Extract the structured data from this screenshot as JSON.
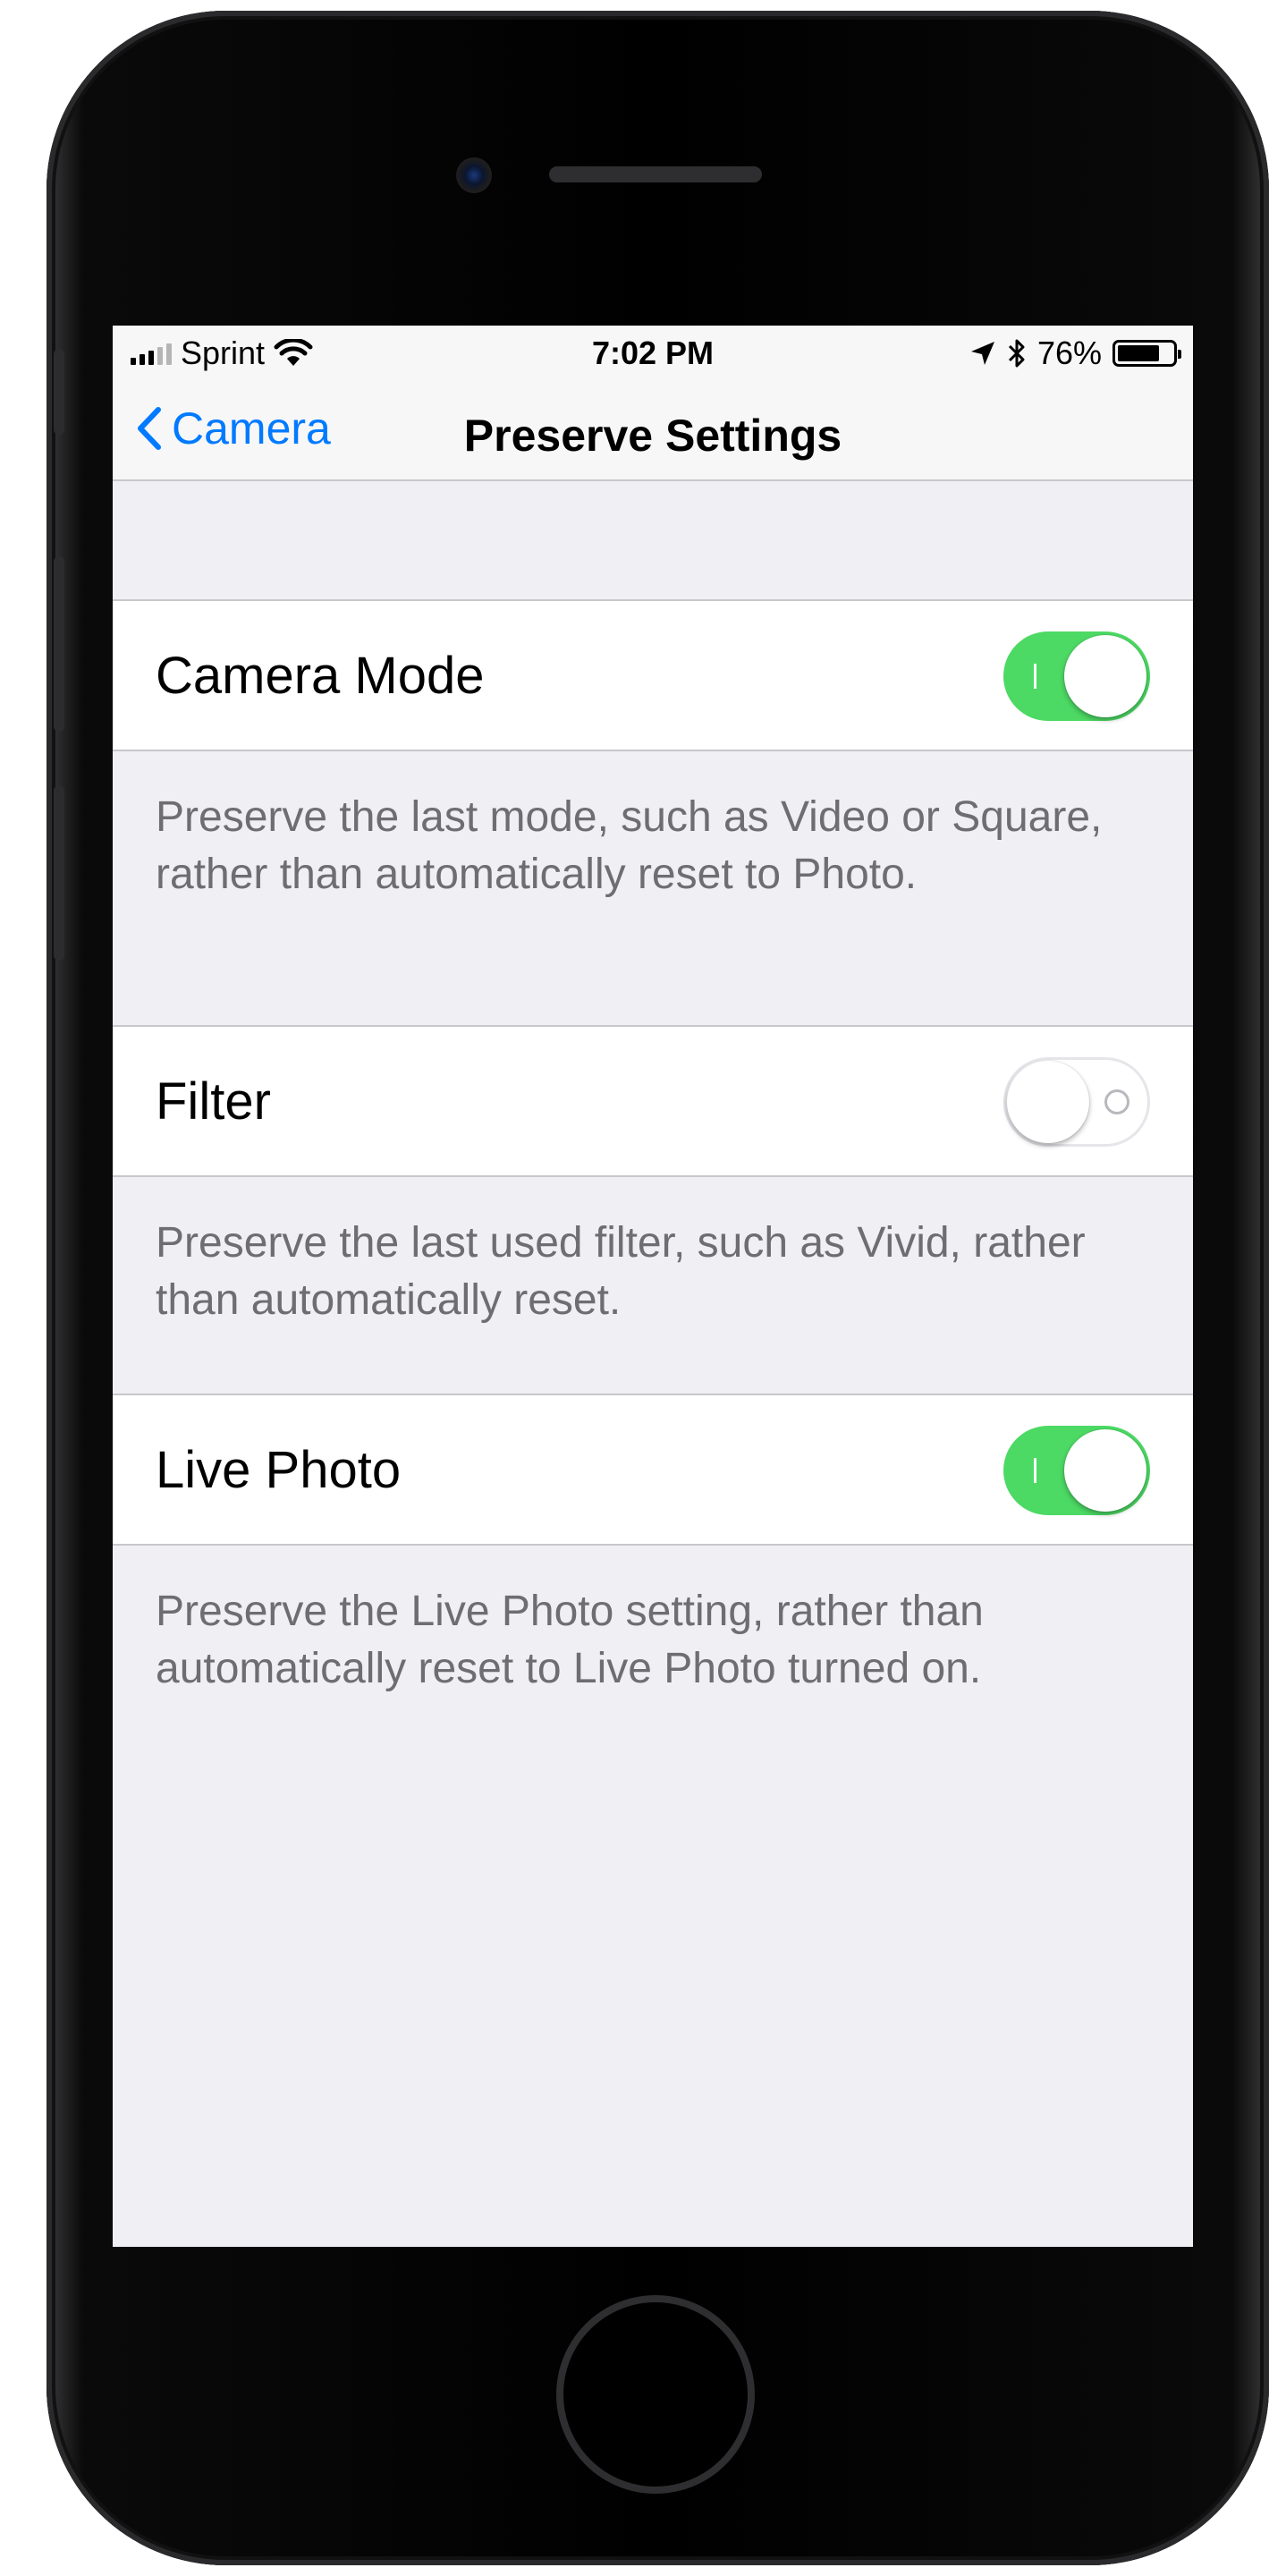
{
  "status_bar": {
    "carrier": "Sprint",
    "time": "7:02 PM",
    "battery_percent": "76%",
    "battery_level": 0.76,
    "icons": [
      "signal-icon",
      "wifi-icon",
      "location-arrow-icon",
      "bluetooth-icon",
      "battery-icon"
    ]
  },
  "nav": {
    "back_label": "Camera",
    "title": "Preserve Settings"
  },
  "settings": [
    {
      "label": "Camera Mode",
      "on": true,
      "description": "Preserve the last mode, such as Video or Square, rather than automatically reset to Photo."
    },
    {
      "label": "Filter",
      "on": false,
      "description": "Preserve the last used filter, such as Vivid, rather than automatically reset."
    },
    {
      "label": "Live Photo",
      "on": true,
      "description": "Preserve the Live Photo setting, rather than automatically reset to Live Photo turned on."
    }
  ],
  "colors": {
    "accent": "#007aff",
    "switch_on": "#4cd964",
    "background": "#efeff4",
    "footer_text": "#6d6d72"
  }
}
